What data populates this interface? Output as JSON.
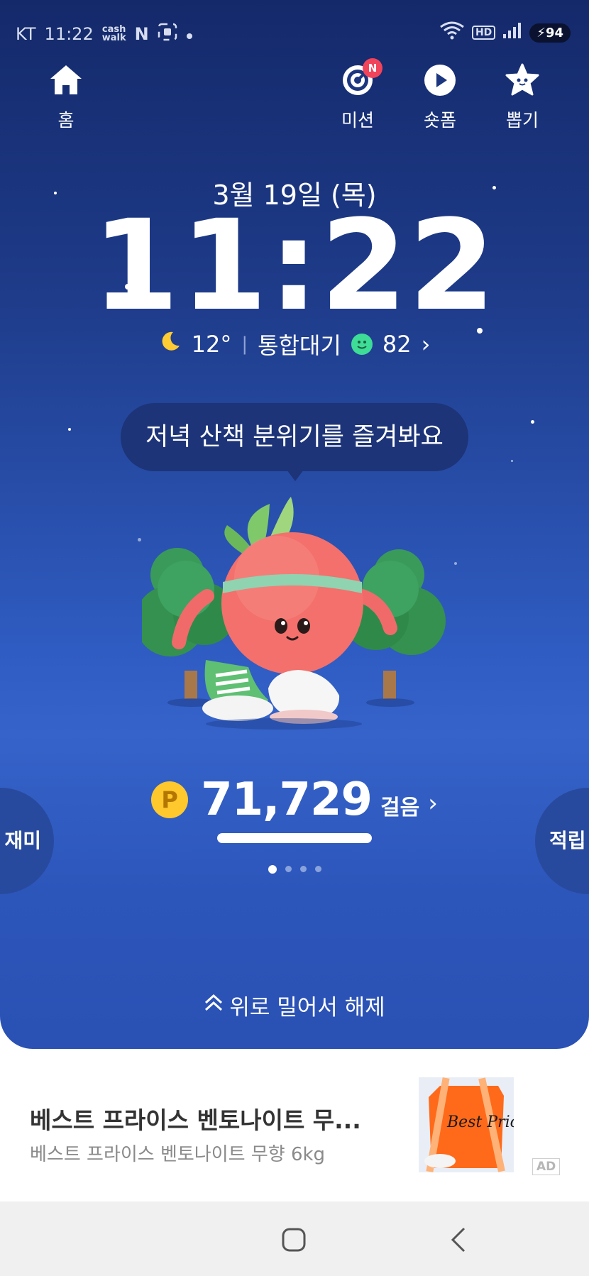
{
  "status_bar": {
    "carrier": "KT",
    "time": "11:22",
    "cash_icon_text": "cash\nwalk",
    "n_badge": "N",
    "hd": "HD",
    "battery": "94"
  },
  "nav": {
    "home_label": "홈",
    "mission_label": "미션",
    "mission_badge": "N",
    "shorts_label": "숏폼",
    "draw_label": "뽑기"
  },
  "clock": {
    "date": "3월 19일 (목)",
    "time": "11:22"
  },
  "weather": {
    "temperature": "12°",
    "air_label": "통합대기",
    "air_value": "82",
    "chevron": "›"
  },
  "bubble_text": "저녁 산책 분위기를 즐겨봐요",
  "steps": {
    "coin": "P",
    "count": "71,729",
    "unit": "걸음",
    "chevron": "›",
    "progress_fraction": 1.0
  },
  "pager": {
    "total": 4,
    "active_index": 0
  },
  "side": {
    "left_label": "재미",
    "right_label": "적립"
  },
  "unlock_text": "위로 밀어서 해제",
  "ad": {
    "title": "베스트 프라이스 벤토나이트 무...",
    "subtitle": "베스트 프라이스 벤토나이트 무향 6kg",
    "tag": "AD",
    "thumb_text": "Best Price"
  },
  "colors": {
    "bg_top": "#14296a",
    "bg_mid": "#3563c9",
    "bubble": "#1d3478",
    "coin": "#ffc82c",
    "badge": "#f0445a",
    "smile": "#3ddc97"
  },
  "icons": [
    "home-icon",
    "target-icon",
    "play-icon",
    "star-icon",
    "moon-icon",
    "smile-icon",
    "double-chevron-up-icon",
    "square-icon",
    "back-icon"
  ]
}
